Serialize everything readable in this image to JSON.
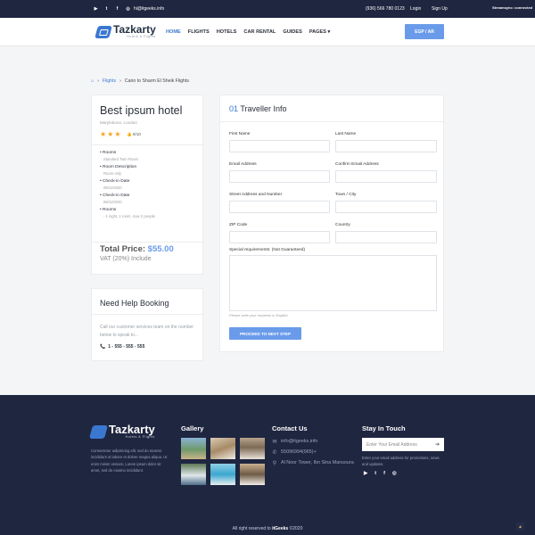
{
  "topbar": {
    "socials": [
      "youtube-icon",
      "twitter-icon",
      "facebook-icon",
      "instagram-icon"
    ],
    "email": "hi@itgeeks.info",
    "phone": "(936) 566 780 0123",
    "login": "Login",
    "signup": "Sign Up",
    "stream_status": "Streamsync: connected"
  },
  "brand": {
    "name": "Tazkarty",
    "tagline": "Hotels & Flights"
  },
  "nav": {
    "items": [
      "HOME",
      "FLIGHTS",
      "HOTELS",
      "CAR RENTAL",
      "GUIDES",
      "PAGES"
    ],
    "active": "HOME",
    "currency_button": "EGP / AR"
  },
  "breadcrumb": {
    "home_icon": "home-icon",
    "link": "Flights",
    "current": "Cairo to Sharm El Sheik Flights"
  },
  "hotel": {
    "title": "Best ipsum hotel",
    "location": "Marylebone, London",
    "stars": 3,
    "rating": "8/10",
    "details": [
      {
        "label": "Rooms",
        "value": "Standard Twin Room"
      },
      {
        "label": "Room Description",
        "value": "Room only"
      },
      {
        "label": "Check-in Date",
        "value": "08/11/2020"
      },
      {
        "label": "Check-in Date",
        "value": "08/11/2020"
      },
      {
        "label": "Rooms",
        "value": "- 1 night, 1 room, max 2 people"
      }
    ],
    "total_label": "Total Price:",
    "total_value": "$55.00",
    "vat": "VAT (20%) Include"
  },
  "help": {
    "title": "Need Help Booking",
    "text": "Call our customer services team on the number below to speak to...",
    "phone": "1 - 555 - 555 - 555"
  },
  "form": {
    "step_number": "01",
    "title": "Traveller Info",
    "fields": {
      "first_name": "First Name",
      "last_name": "Last Name",
      "email": "Email Address",
      "confirm_email": "Confirm Email Address",
      "street": "Street Address and Number",
      "town": "Town / City",
      "zip": "ZIP Code",
      "country": "Country",
      "special": "Special requirements: (Not Guaranteed)"
    },
    "hint": "Please write your requests in English.",
    "submit": "PROCEED TO NEXT STEP"
  },
  "footer": {
    "description": "Consectetur adipisicing elit, sed do eiusmo incididunt ut labore et dolore magna aliqua. Ut enim minim veniam, Lorem ipsum dolor sit amet, sed do eiusmo incididunt.",
    "gallery_title": "Gallery",
    "contact_title": "Contact Us",
    "contact": {
      "email": "info@itgeeks.info",
      "phone": "55096994(965)+",
      "address": "Al Noor Tower, Ibn Sina Mansoura"
    },
    "touch_title": "Stay In Touch",
    "subscribe_placeholder": "Enter Your Email Address",
    "subscribe_desc": "Enter your email address for promotions, news and updates.",
    "socials": [
      "youtube-icon",
      "twitter-icon",
      "facebook-icon",
      "instagram-icon"
    ],
    "copyright_prefix": "All right reserved to",
    "copyright_brand": "itGeeks",
    "copyright_suffix": "©2020"
  },
  "colors": {
    "accent": "#3a78d0",
    "button": "#6a9bea",
    "dark": "#1f2640",
    "star": "#f6a623"
  }
}
